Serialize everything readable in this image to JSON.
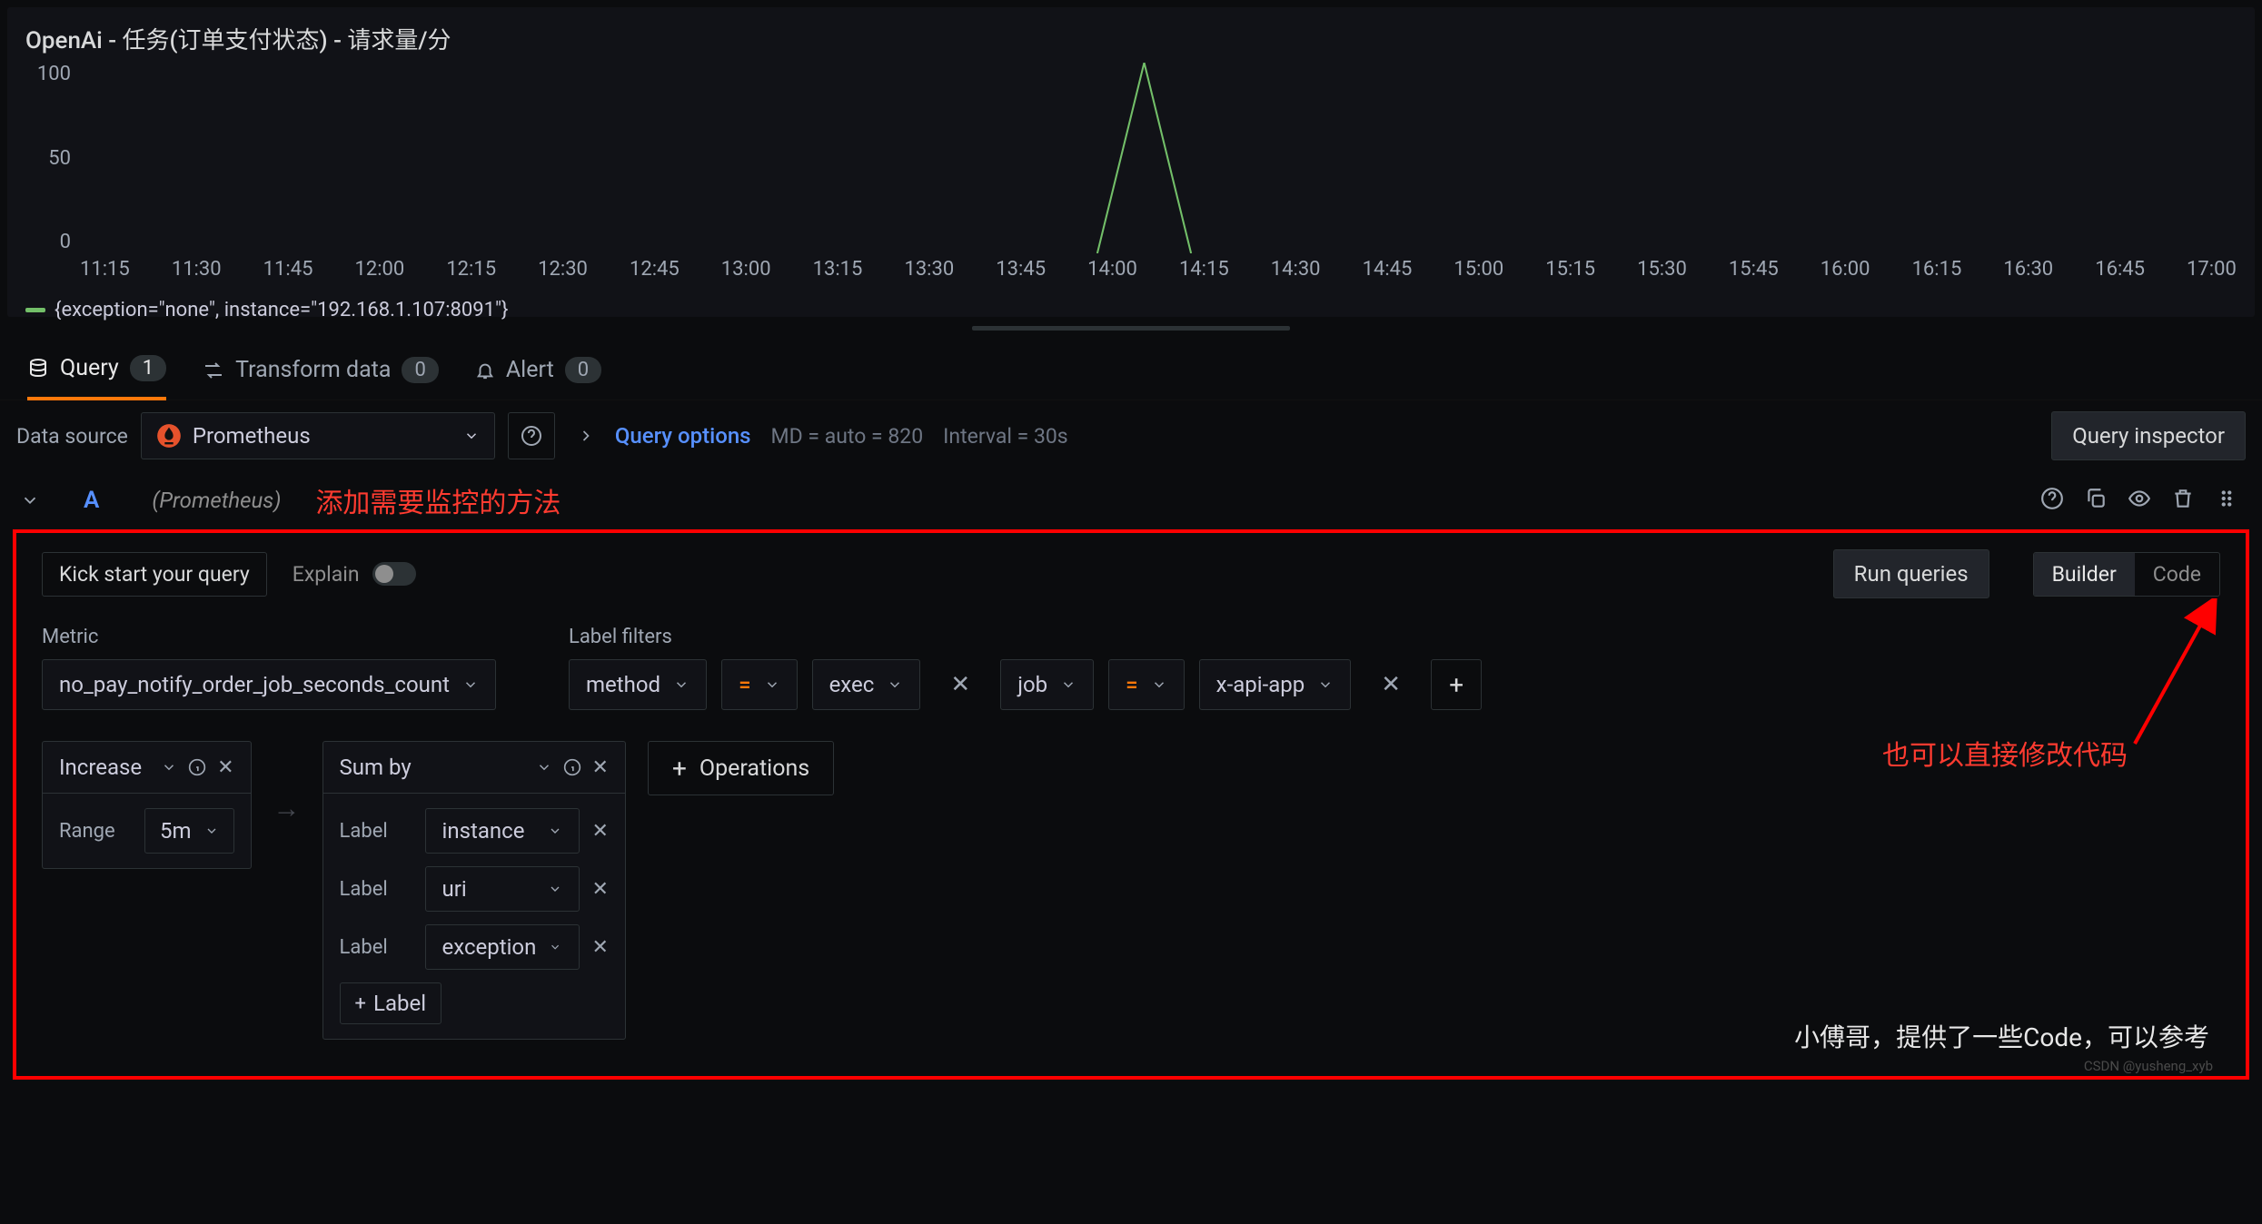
{
  "panel": {
    "title": "OpenAi - 任务(订单支付状态) - 请求量/分"
  },
  "chart_data": {
    "type": "line",
    "x_labels": [
      "11:15",
      "11:30",
      "11:45",
      "12:00",
      "12:15",
      "12:30",
      "12:45",
      "13:00",
      "13:15",
      "13:30",
      "13:45",
      "14:00",
      "14:15",
      "14:30",
      "14:45",
      "15:00",
      "15:15",
      "15:30",
      "15:45",
      "16:00",
      "16:15",
      "16:30",
      "16:45",
      "17:00"
    ],
    "y_ticks": [
      100,
      50,
      0
    ],
    "ylim": [
      0,
      100
    ],
    "series": [
      {
        "name": "{exception=\"none\", instance=\"192.168.1.107:8091\"}",
        "color": "#73bf69",
        "values": [
          null,
          null,
          null,
          null,
          null,
          null,
          null,
          null,
          null,
          null,
          null,
          0,
          100,
          0,
          null,
          null,
          null,
          null,
          null,
          null,
          null,
          null,
          null,
          null
        ]
      }
    ]
  },
  "tabs": {
    "query": {
      "label": "Query",
      "count": "1"
    },
    "transform": {
      "label": "Transform data",
      "count": "0"
    },
    "alert": {
      "label": "Alert",
      "count": "0"
    }
  },
  "datasource": {
    "label": "Data source",
    "selected": "Prometheus"
  },
  "query_options": {
    "link": "Query options",
    "md": "MD = auto = 820",
    "interval": "Interval = 30s"
  },
  "inspector_btn": "Query inspector",
  "query_row": {
    "letter": "A",
    "ds": "(Prometheus)"
  },
  "annotations": {
    "top": "添加需要监控的方法",
    "code_hint": "也可以直接修改代码",
    "footnote": "小傅哥，提供了一些Code，可以参考",
    "watermark": "CSDN @yusheng_xyb"
  },
  "builder": {
    "kick": "Kick start your query",
    "explain": "Explain",
    "run": "Run queries",
    "mode_builder": "Builder",
    "mode_code": "Code",
    "metric_label": "Metric",
    "metric_value": "no_pay_notify_order_job_seconds_count",
    "label_filters_label": "Label filters",
    "filters": [
      {
        "key": "method",
        "op": "=",
        "value": "exec"
      },
      {
        "key": "job",
        "op": "=",
        "value": "x-api-app"
      }
    ],
    "ops": {
      "increase": {
        "title": "Increase",
        "range_label": "Range",
        "range_value": "5m"
      },
      "sumby": {
        "title": "Sum by",
        "label_label": "Label",
        "labels": [
          "instance",
          "uri",
          "exception"
        ],
        "add_label": "Label"
      },
      "add_btn": "Operations"
    }
  }
}
